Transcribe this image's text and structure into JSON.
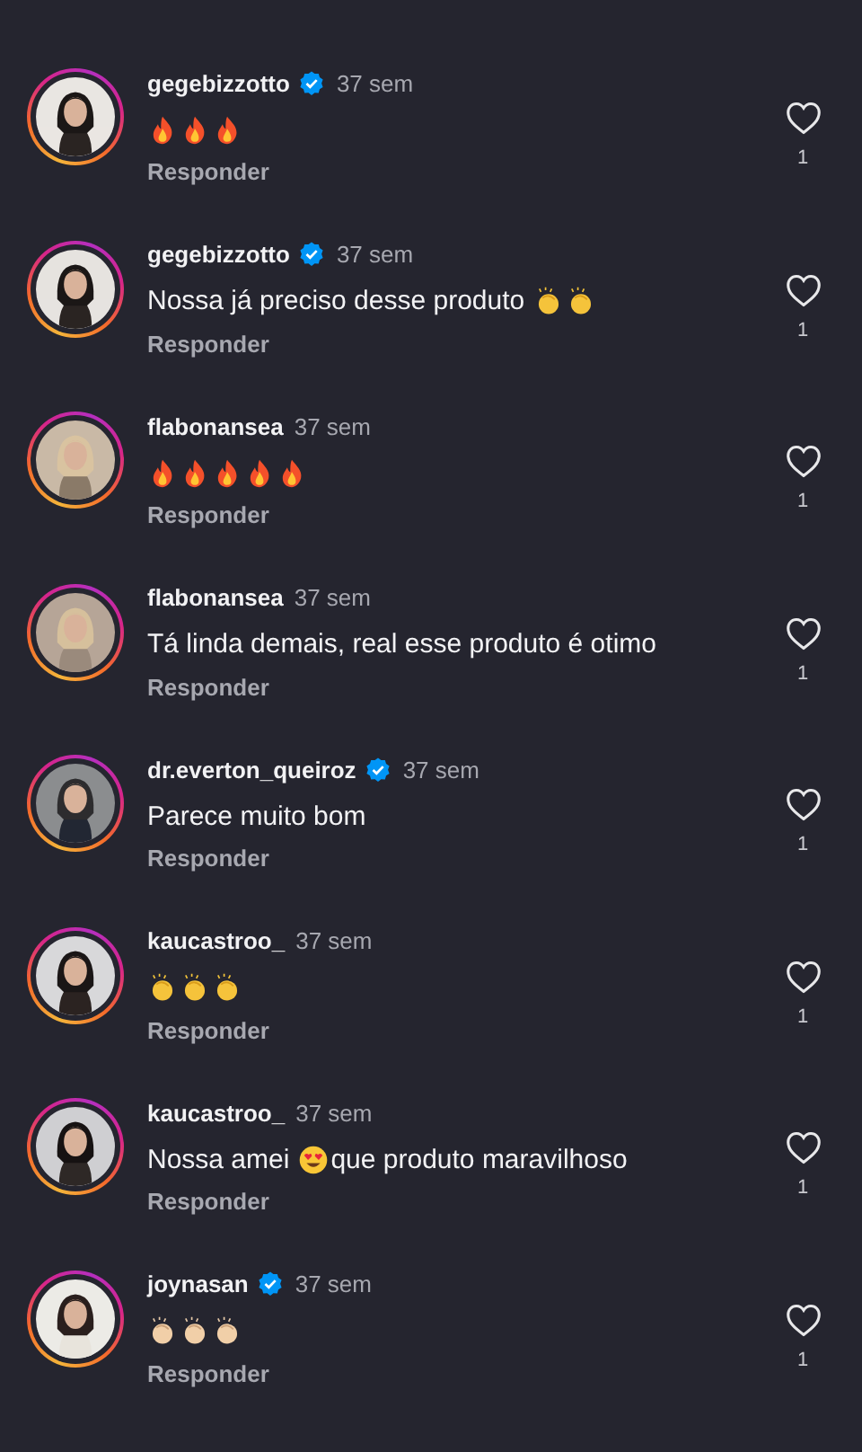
{
  "comments": [
    {
      "user": "gegebizzotto",
      "verified": true,
      "time": "37 sem",
      "body": [
        {
          "kind": "fire"
        },
        {
          "kind": "fire"
        },
        {
          "kind": "fire"
        }
      ],
      "reply": "Responder",
      "likes": "1"
    },
    {
      "user": "gegebizzotto",
      "verified": true,
      "time": "37 sem",
      "body": [
        {
          "kind": "text",
          "text": "Nossa já preciso desse produto"
        },
        {
          "kind": "clap"
        },
        {
          "kind": "clap"
        }
      ],
      "reply": "Responder",
      "likes": "1"
    },
    {
      "user": "flabonansea",
      "verified": false,
      "time": "37 sem",
      "body": [
        {
          "kind": "fire"
        },
        {
          "kind": "fire"
        },
        {
          "kind": "fire"
        },
        {
          "kind": "fire"
        },
        {
          "kind": "fire"
        }
      ],
      "reply": "Responder",
      "likes": "1"
    },
    {
      "user": "flabonansea",
      "verified": false,
      "time": "37 sem",
      "body": [
        {
          "kind": "text",
          "text": "Tá linda demais, real esse produto é otimo"
        }
      ],
      "reply": "Responder",
      "likes": "1"
    },
    {
      "user": "dr.everton_queiroz",
      "verified": true,
      "time": "37 sem",
      "body": [
        {
          "kind": "text",
          "text": "Parece muito bom"
        }
      ],
      "reply": "Responder",
      "likes": "1"
    },
    {
      "user": "kaucastroo_",
      "verified": false,
      "time": "37 sem",
      "body": [
        {
          "kind": "clap"
        },
        {
          "kind": "clap"
        },
        {
          "kind": "clap"
        }
      ],
      "reply": "Responder",
      "likes": "1"
    },
    {
      "user": "kaucastroo_",
      "verified": false,
      "time": "37 sem",
      "body": [
        {
          "kind": "text",
          "text": "Nossa amei"
        },
        {
          "kind": "heart-eyes"
        },
        {
          "kind": "text",
          "text": "que produto maravilhoso"
        }
      ],
      "reply": "Responder",
      "likes": "1"
    },
    {
      "user": "joynasan",
      "verified": true,
      "time": "37 sem",
      "body": [
        {
          "kind": "clap-light"
        },
        {
          "kind": "clap-light"
        },
        {
          "kind": "clap-light"
        }
      ],
      "reply": "Responder",
      "likes": "1"
    }
  ]
}
